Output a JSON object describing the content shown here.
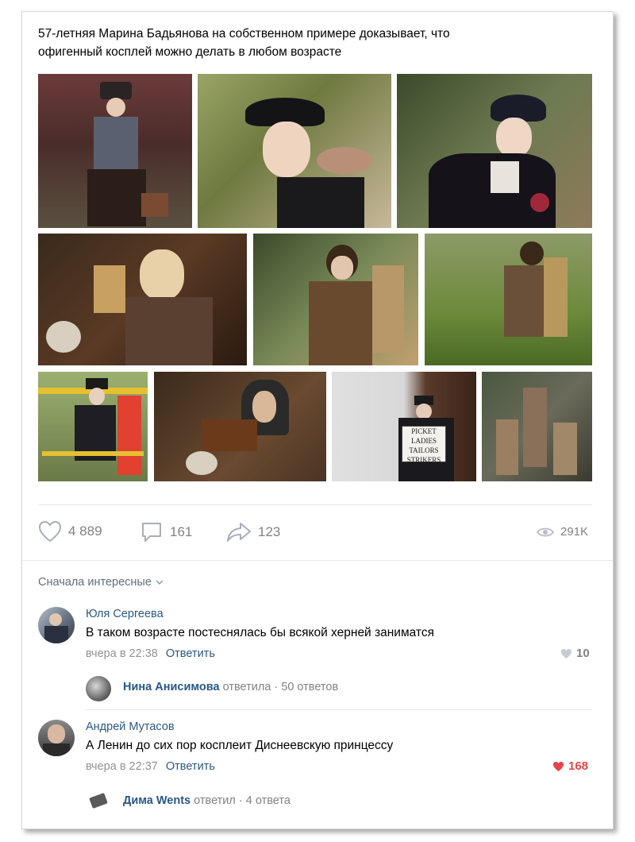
{
  "post": {
    "text_line1": "57-летняя Марина Бадьянова на собственном примере доказывает, что",
    "text_line2": "офигенный косплей можно делать в любом возрасте"
  },
  "stats": {
    "likes": "4 889",
    "comments": "161",
    "shares": "123",
    "views": "291K"
  },
  "sort_label": "Сначала интересные",
  "comments": [
    {
      "author": "Юля Сергеева",
      "text": "В таком возрасте постеснялась бы всякой херней заниматся",
      "time": "вчера в 22:38",
      "reply_label": "Ответить",
      "likes": "10",
      "thread": {
        "who": "Нина Анисимова",
        "action": "ответила",
        "count": "50 ответов"
      }
    },
    {
      "author": "Андрей Мутасов",
      "text": "А Ленин до сих пор косплеит Диснеевскую принцессу",
      "time": "вчера в 22:37",
      "reply_label": "Ответить",
      "likes": "168",
      "thread": {
        "who": "Дима Wents",
        "action": "ответил",
        "count": "4 ответа"
      }
    }
  ],
  "colors": {
    "link": "#2a5885",
    "meta": "#939393",
    "liked": "#e64646",
    "icon": "#a8aeb8"
  }
}
